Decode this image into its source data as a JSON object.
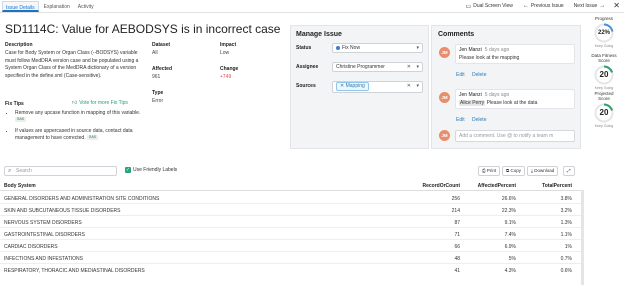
{
  "tabs": [
    "Issue Details",
    "Explanation",
    "Activity"
  ],
  "topbar": {
    "dual_screen": "Dual Screen View",
    "previous": "Previous Issue",
    "next": "Next Issue",
    "close": "✕"
  },
  "issue": {
    "title": "SD1114C: Value for AEBODSYS is in incorrect case",
    "description_label": "Description",
    "description": "Case for Body System or Organ Class (--BODSYS) variable must follow MedDRA version case and be populated using a System Organ Class of the MedDRA dictionary of a version specified in the define.xml (Case-sensitive).",
    "dataset_label": "Dataset",
    "dataset": "All",
    "impact_label": "Impact",
    "impact": "Low",
    "affected_label": "Affected",
    "affected": "961",
    "change_label": "Change",
    "change": "+749",
    "type_label": "Type",
    "type": "Error",
    "fix_tips_label": "Fix Tips",
    "vote_label": "Vote for more Fix Tips",
    "fix_tips": [
      {
        "text": "Remove any upcase function in mapping of this variable.",
        "badge": "SAS"
      },
      {
        "text": "If values are uppercased in source data, contact data management to have corrected.",
        "badge": "SAS"
      }
    ]
  },
  "manage": {
    "title": "Manage Issue",
    "status_label": "Status",
    "status_value": "Fix Now",
    "assignee_label": "Assignee",
    "assignee_value": "Christine Programmer",
    "sources_label": "Sources",
    "sources_chip": "Mapping"
  },
  "comments": {
    "title": "Comments",
    "items": [
      {
        "initials": "JM",
        "name": "Jen Manzi",
        "ago": "5 days ago",
        "text": "Please look at the mapping",
        "mention": ""
      },
      {
        "initials": "JM",
        "name": "Jen Manzi",
        "ago": "5 days ago",
        "text": "Please look at the data",
        "mention": "Alice Perry"
      }
    ],
    "edit": "Edit",
    "delete": "Delete",
    "input_initials": "JM",
    "input_placeholder": "Add a comment. Use @ to notify a team m"
  },
  "scores": [
    {
      "label": "Progress",
      "value": "22%",
      "sub": "Keep Going",
      "color": "#4a90d9",
      "fraction": 0.22
    },
    {
      "label": "Data Fitness Score",
      "value": "20",
      "sub": "Keep Going",
      "color": "#2ea36c",
      "fraction": 0.2
    },
    {
      "label": "Projected Score",
      "value": "20",
      "sub": "Keep Going",
      "color": "#2ea36c",
      "fraction": 0.2
    }
  ],
  "toolbar": {
    "search_placeholder": "Search",
    "friendly_labels": "Use Friendly Labels",
    "print": "Print",
    "copy": "Copy",
    "download": "Download"
  },
  "table": {
    "headers": [
      "Body System",
      "RecordOrCount",
      "AffectedPercent",
      "TotalPercent"
    ],
    "rows": [
      [
        "GENERAL DISORDERS AND ADMINISTRATION SITE CONDITIONS",
        "256",
        "26.6%",
        "3.8%"
      ],
      [
        "SKIN AND SUBCUTANEOUS TISSUE DISORDERS",
        "214",
        "22.3%",
        "3.2%"
      ],
      [
        "NERVOUS SYSTEM DISORDERS",
        "87",
        "9.1%",
        "1.3%"
      ],
      [
        "GASTROINTESTINAL DISORDERS",
        "71",
        "7.4%",
        "1.1%"
      ],
      [
        "CARDIAC DISORDERS",
        "66",
        "6.9%",
        "1%"
      ],
      [
        "INFECTIONS AND INFESTATIONS",
        "48",
        "5%",
        "0.7%"
      ],
      [
        "RESPIRATORY, THORACIC AND MEDIASTINAL DISORDERS",
        "41",
        "4.3%",
        "0.6%"
      ]
    ]
  }
}
